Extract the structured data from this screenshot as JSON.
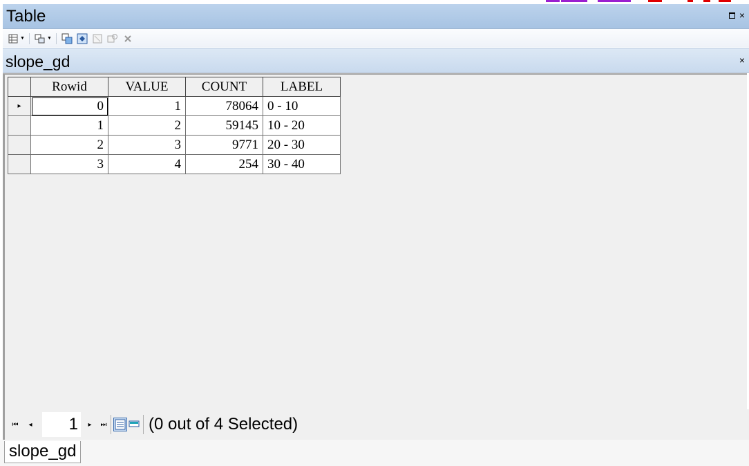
{
  "window": {
    "title": "Table",
    "controls": {
      "restore_icon": "restore-icon",
      "close_glyph": "×"
    }
  },
  "toolbar": {
    "icons": [
      "table-options-icon",
      "related-tables-icon",
      "select-by-attributes-icon",
      "switch-selection-icon",
      "clear-selection-icon",
      "zoom-to-selected-icon",
      "delete-selected-icon"
    ]
  },
  "tab": {
    "title": "slope_gd",
    "close_glyph": "×"
  },
  "grid": {
    "columns": [
      "Rowid",
      "VALUE",
      "COUNT",
      "LABEL"
    ],
    "rows": [
      {
        "rowid": "0",
        "value": "1",
        "count": "78064",
        "label": "0 - 10",
        "current": true
      },
      {
        "rowid": "1",
        "value": "2",
        "count": "59145",
        "label": "10 - 20"
      },
      {
        "rowid": "2",
        "value": "3",
        "count": "9771",
        "label": "20 - 30"
      },
      {
        "rowid": "3",
        "value": "4",
        "count": "254",
        "label": "30 - 40"
      }
    ],
    "current_row_marker": "▸"
  },
  "navigation": {
    "first": "⏮",
    "prev": "◂",
    "current_record": "1",
    "next": "▸",
    "last": "⏭",
    "selection_status": "(0 out of 4 Selected)"
  },
  "bottom_tabs": [
    {
      "label": "slope_gd"
    }
  ],
  "colors": {
    "titlebar": "#bcd3ec",
    "grid_bg": "#f0f0f0",
    "accent": "#3b6db0"
  }
}
